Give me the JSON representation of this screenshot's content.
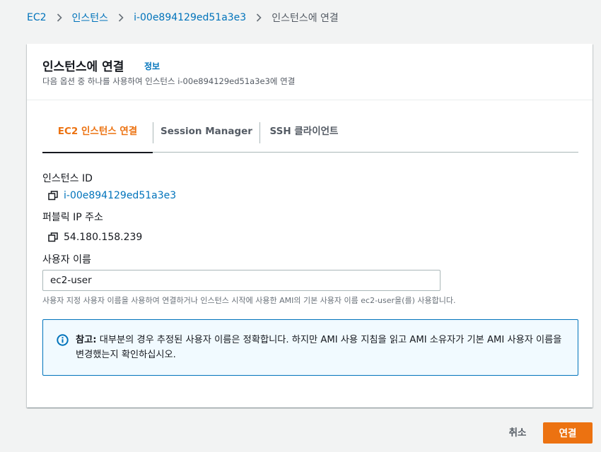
{
  "breadcrumb": {
    "items": [
      "EC2",
      "인스턴스",
      "i-00e894129ed51a3e3"
    ],
    "current": "인스턴스에 연결"
  },
  "panel": {
    "title": "인스턴스에 연결",
    "info_link": "정보",
    "description": "다음 옵션 중 하나를 사용하여 인스턴스 i-00e894129ed51a3e3에 연결"
  },
  "tabs": [
    {
      "label": "EC2 인스턴스 연결",
      "active": true
    },
    {
      "label": "Session Manager",
      "active": false
    },
    {
      "label": "SSH 클라이언트",
      "active": false
    }
  ],
  "fields": {
    "instance_id_label": "인스턴스 ID",
    "instance_id_value": "i-00e894129ed51a3e3",
    "public_ip_label": "퍼블릭 IP 주소",
    "public_ip_value": "54.180.158.239",
    "username_label": "사용자 이름",
    "username_value": "ec2-user",
    "username_hint": "사용자 지정 사용자 이름을 사용하여 연결하거나 인스턴스 시작에 사용한 AMI의 기본 사용자 이름 ec2-user을(를) 사용합니다."
  },
  "alert": {
    "prefix": "참고:",
    "text": " 대부분의 경우 추정된 사용자 이름은 정확합니다. 하지만 AMI 사용 지침을 읽고 AMI 소유자가 기본 AMI 사용자 이름을 변경했는지 확인하십시오."
  },
  "actions": {
    "cancel_label": "취소",
    "connect_label": "연결"
  },
  "colors": {
    "accent": "#ec7211",
    "link": "#0073bb",
    "info_border": "#0073bb",
    "info_bg": "#f1faff"
  },
  "icons": {
    "breadcrumb_separator": "chevron-right-icon",
    "copy": "copy-icon",
    "info": "info-circle-icon"
  }
}
